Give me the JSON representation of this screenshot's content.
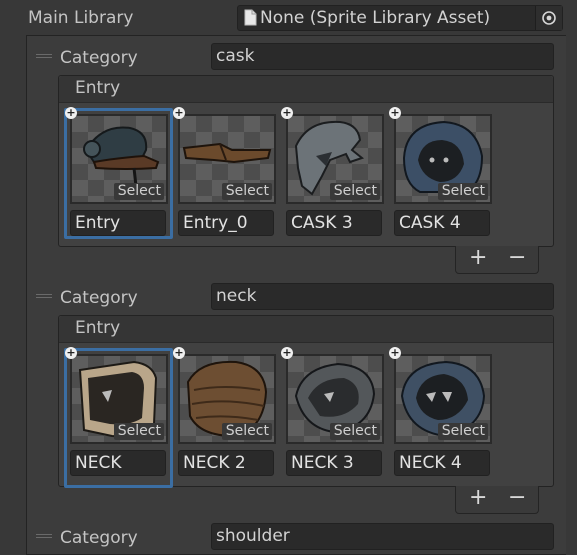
{
  "main_library": {
    "label": "Main Library",
    "value": "None (Sprite Library Asset)"
  },
  "categories": [
    {
      "label": "Category",
      "name": "cask",
      "entry_header": "Entry",
      "items": [
        {
          "name": "Entry",
          "select": "Select"
        },
        {
          "name": "Entry_0",
          "select": "Select"
        },
        {
          "name": "CASK 3",
          "select": "Select"
        },
        {
          "name": "CASK 4",
          "select": "Select"
        }
      ]
    },
    {
      "label": "Category",
      "name": "neck",
      "entry_header": "Entry",
      "items": [
        {
          "name": "NECK",
          "select": "Select"
        },
        {
          "name": "NECK 2",
          "select": "Select"
        },
        {
          "name": "NECK 3",
          "select": "Select"
        },
        {
          "name": "NECK 4",
          "select": "Select"
        }
      ]
    },
    {
      "label": "Category",
      "name": "shoulder"
    }
  ],
  "list_controls": {
    "add": "+",
    "remove": "−"
  },
  "colors": {
    "selection": "#3b6ea3",
    "background": "#383838",
    "field": "#2a2a2a"
  },
  "icons": [
    "document-icon",
    "object-picker-icon",
    "drag-handle-icon",
    "add-badge-icon"
  ]
}
